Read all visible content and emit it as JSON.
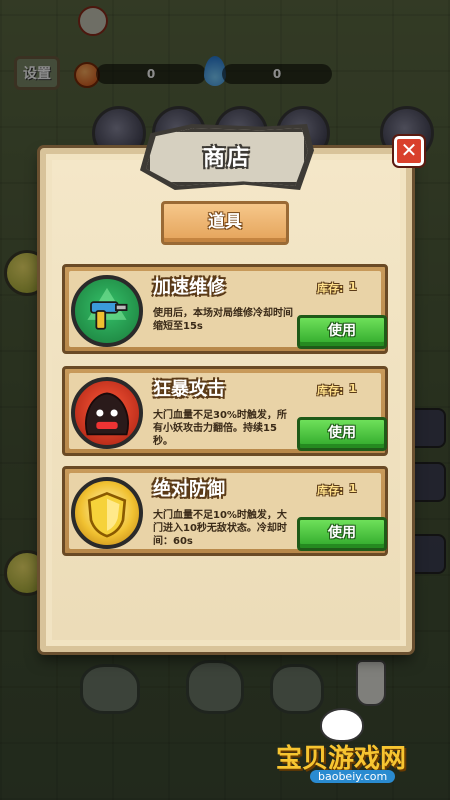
{
  "hud": {
    "settings_label": "设置",
    "coins_value": "0",
    "energy_value": "0"
  },
  "shop": {
    "title": "商店",
    "tab_label": "道具",
    "stock_label": "库存:",
    "items": [
      {
        "name": "加速维修",
        "stock": "1",
        "description": "使用后，本场对局维修冷却时间缩短至15s",
        "button_label": "使用",
        "icon": "drill-icon",
        "color": "#35c26a"
      },
      {
        "name": "狂暴攻击",
        "stock": "1",
        "description": "大门血量不足30%时触发，所有小妖攻击力翻倍。持续15秒。",
        "button_label": "使用",
        "icon": "rage-monster-icon",
        "color": "#ff5a3a"
      },
      {
        "name": "绝对防御",
        "stock": "1",
        "description": "大门血量不足10%时触发，大门进入10秒无敌状态。冷却时间：60s",
        "button_label": "使用",
        "icon": "shield-icon",
        "color": "#f1c232"
      }
    ]
  },
  "watermark": {
    "text": "宝贝游戏网",
    "url": "baobeiy.com"
  },
  "colors": {
    "panel_bg": "#f1e3c2",
    "close_red": "#d9402c",
    "use_green": "#2fa82a",
    "tab_orange": "#e4a35a"
  }
}
